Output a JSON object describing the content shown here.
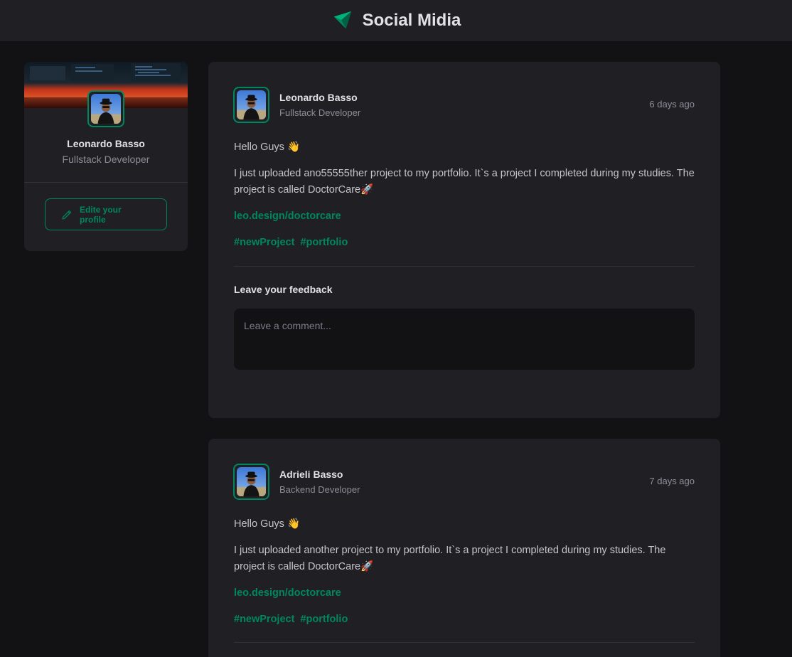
{
  "header": {
    "title": "Social Midia",
    "logo_icon": "paper-plane-logo-icon",
    "accent": "#00875f"
  },
  "sidebar": {
    "cover_image": "desk-setup-cover",
    "profile": {
      "name": "Leonardo Basso",
      "role": "Fullstack Developer"
    },
    "edit_button": {
      "icon": "pencil-icon",
      "label": "Edite your profile"
    }
  },
  "posts": [
    {
      "author": {
        "name": "Leonardo Basso",
        "role": "Fullstack Developer"
      },
      "time": "6 days ago",
      "greeting": "Hello Guys 👋",
      "body": "I just uploaded ano55555ther project to my portfolio. It`s a project I completed during my studies. The project is called DoctorCare🚀",
      "link": "leo.design/doctorcare",
      "tags": [
        "#newProject",
        "#portfolio"
      ],
      "feedback_title": "Leave your feedback",
      "comment_placeholder": "Leave a comment..."
    },
    {
      "author": {
        "name": "Adrieli Basso",
        "role": "Backend Developer"
      },
      "time": "7 days ago",
      "greeting": "Hello Guys 👋",
      "body": "I just uploaded another project to my portfolio. It`s a project I completed during my studies. The project is called DoctorCare🚀",
      "link": "leo.design/doctorcare",
      "tags": [
        "#newProject",
        "#portfolio"
      ]
    }
  ],
  "colors": {
    "background": "#121214",
    "card": "#202024",
    "accent": "#00875f",
    "text": "#e1e1e6",
    "muted": "#8d8d99"
  }
}
